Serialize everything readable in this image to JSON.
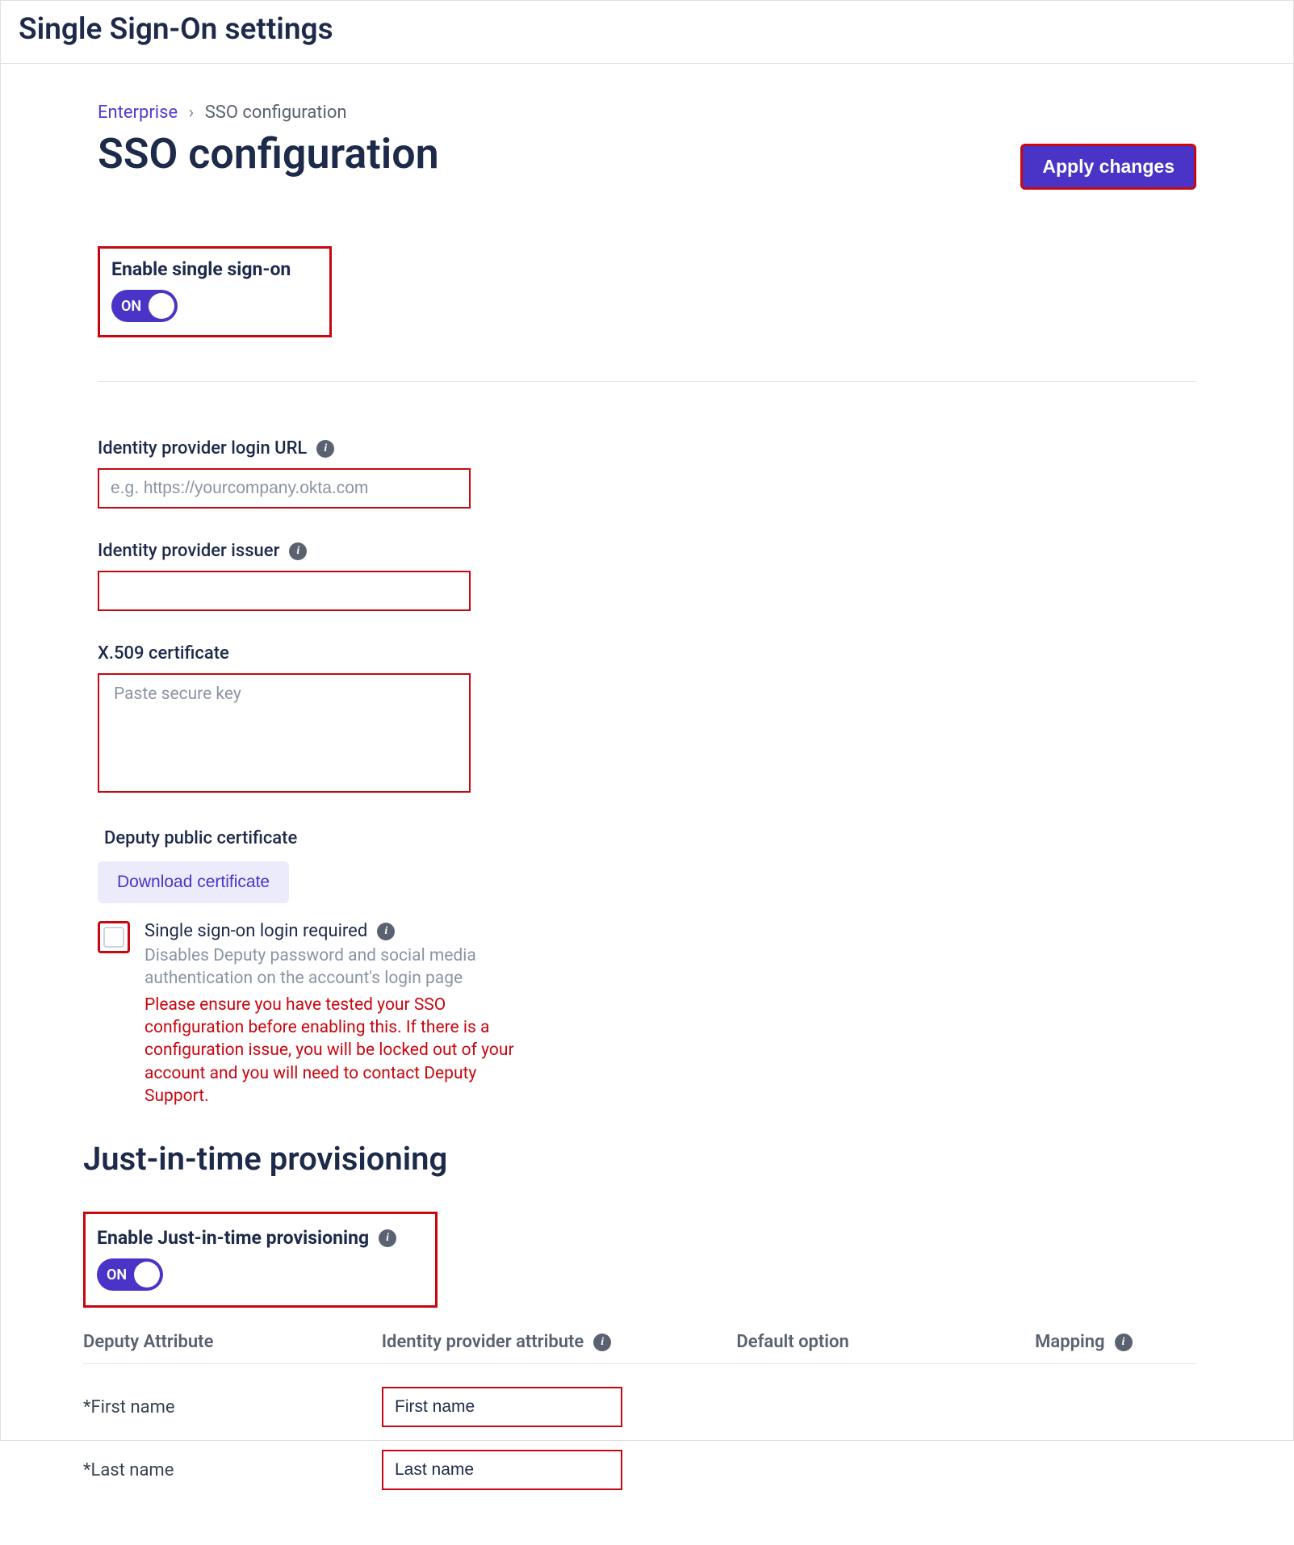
{
  "header": {
    "title": "Single Sign-On settings"
  },
  "breadcrumb": {
    "root": "Enterprise",
    "sep": "›",
    "current": "SSO configuration"
  },
  "page": {
    "title": "SSO configuration",
    "apply": "Apply changes"
  },
  "enable_sso": {
    "label": "Enable single sign-on",
    "state": "ON"
  },
  "idp_url": {
    "label": "Identity provider login URL",
    "placeholder": "e.g. https://yourcompany.okta.com",
    "value": ""
  },
  "idp_issuer": {
    "label": "Identity provider issuer",
    "value": ""
  },
  "x509": {
    "label": "X.509 certificate",
    "placeholder": "Paste secure key",
    "value": ""
  },
  "deputy_cert": {
    "label": "Deputy public certificate",
    "button": "Download certificate"
  },
  "sso_required": {
    "label": "Single sign-on login required",
    "desc": "Disables Deputy password and social media authentication on the account's login page",
    "warn": "Please ensure you have tested your SSO configuration before enabling this. If there is a configuration issue, you will be locked out of your account and you will need to contact Deputy Support."
  },
  "jit": {
    "heading": "Just-in-time provisioning",
    "enable_label": "Enable Just-in-time provisioning",
    "state": "ON"
  },
  "table": {
    "cols": {
      "deputy": "Deputy Attribute",
      "idp": "Identity provider attribute",
      "default": "Default option",
      "mapping": "Mapping"
    },
    "rows": [
      {
        "deputy": "*First name",
        "idp": "First name"
      },
      {
        "deputy": "*Last name",
        "idp": "Last name"
      }
    ]
  }
}
